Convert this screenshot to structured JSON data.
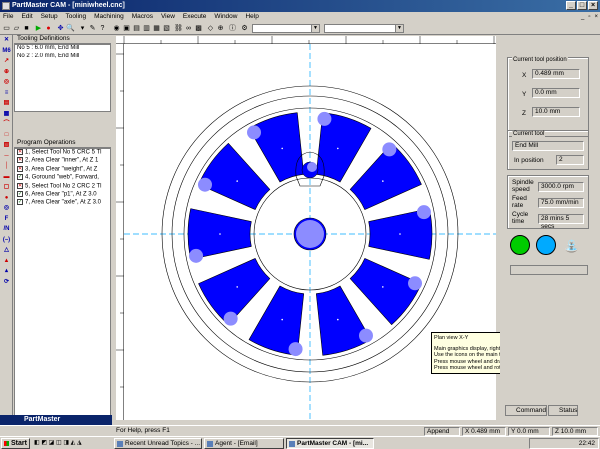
{
  "window": {
    "title": "PartMaster CAM - [miniwheel.cnc]"
  },
  "menu": [
    "File",
    "Edit",
    "Setup",
    "Tooling",
    "Machining",
    "Macros",
    "View",
    "Execute",
    "Window",
    "Help"
  ],
  "tooling": {
    "header": "Tooling Definitions",
    "items": [
      "No 5 : 6.0 mm, End Mill",
      "No 2 : 2.0 mm, End Mill"
    ]
  },
  "operations": {
    "header": "Program Operations",
    "items": [
      {
        "n": "1, Select Tool No 5 CRC 5 Tl",
        "state": "x"
      },
      {
        "n": "2, Area Clear \"inner\", At Z 1",
        "state": "x"
      },
      {
        "n": "3, Area Clear \"weight\", At Z",
        "state": "x"
      },
      {
        "n": "4, Goround \"web\", Forward,",
        "state": "c"
      },
      {
        "n": "5, Select Tool No 2 CRC 2 Tl",
        "state": "x"
      },
      {
        "n": "6, Area Clear \"p1\", At Z 3.0",
        "state": "c"
      },
      {
        "n": "7, Area Clear \"axle\", At Z 3.0",
        "state": "c"
      }
    ]
  },
  "left_logo": "PartMaster",
  "left_tools": [
    "✕",
    "M6",
    "↗",
    "⊕",
    "◎",
    "≡",
    "▤",
    "▦",
    "⌒",
    "□",
    "▧",
    "─",
    "│",
    "▬",
    "▢",
    "●",
    "◎",
    "F",
    "/N",
    "(–)",
    "△",
    "▲",
    "▴",
    "⟳"
  ],
  "current_tool_position": {
    "title": "Current tool position",
    "x_label": "X",
    "x_value": "0.489 mm",
    "y_label": "Y",
    "y_value": "0.0 mm",
    "z_label": "Z",
    "z_value": "10.0 mm"
  },
  "current_tool": {
    "title": "Current tool",
    "name": "End Mill",
    "in_position_label": "In position",
    "in_position_value": "2"
  },
  "machine": {
    "spindle_label": "Spindle speed",
    "spindle_value": "3000.0 rpm",
    "feed_label": "Feed rate",
    "feed_value": "75.0 mm/min",
    "cycle_label": "Cycle time",
    "cycle_value": "28 mins 5 secs"
  },
  "tabs": {
    "command": "Command",
    "status": "Status"
  },
  "tooltip": {
    "title": "Plan view  X-Y",
    "lines": [
      "Main graphics display, right click to set options.",
      "Use the icons on the main toolbar to select view point, zoom etc.",
      "Press mouse wheel and drag to pan the display",
      "Press mouse wheel and rotate to zoom in or out."
    ]
  },
  "statusbar": {
    "help": "For Help, press F1",
    "mode": "Append",
    "x_label": "X",
    "x": "0.489 mm",
    "y_label": "Y",
    "y": "0.0 mm",
    "z_label": "Z",
    "z": "10.0 mm"
  },
  "taskbar": {
    "start": "Start",
    "tasks": [
      "Recent Unread Topics - ...",
      "Agent - [Email]",
      "PartMaster CAM - [mi..."
    ],
    "clock": "22:42"
  },
  "colors": {
    "pocket": "#0000ff",
    "pocket_highlight": "#8c8cff",
    "center_line": "#00a8ff"
  }
}
